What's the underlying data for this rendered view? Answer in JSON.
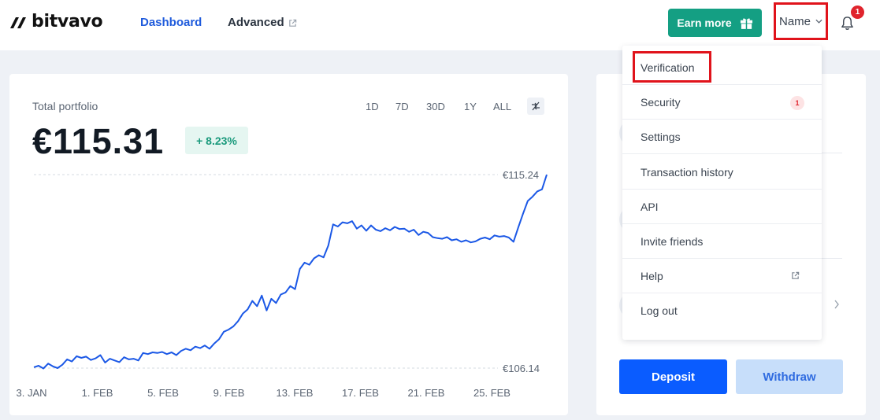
{
  "header": {
    "logo_text": "bitvavo",
    "nav": {
      "dashboard": "Dashboard",
      "advanced": "Advanced"
    },
    "earn_more_label": "Earn more",
    "user_name": "Name",
    "notification_count": "1"
  },
  "portfolio": {
    "label": "Total portfolio",
    "amount": "€115.31",
    "change": "+ 8.23%",
    "ranges": [
      "1D",
      "7D",
      "30D",
      "1Y",
      "ALL"
    ],
    "active_range": "30D"
  },
  "chart_data": {
    "type": "line",
    "x_tick_labels": [
      "3. JAN",
      "1. FEB",
      "5. FEB",
      "9. FEB",
      "13. FEB",
      "17. FEB",
      "21. FEB",
      "25. FEB"
    ],
    "reference_labels": {
      "high": "€115.24",
      "low": "€106.14"
    },
    "ylim": [
      106.14,
      115.24
    ],
    "series": [
      {
        "values": [
          106.18,
          106.25,
          106.12,
          106.35,
          106.22,
          106.14,
          106.3,
          106.55,
          106.45,
          106.7,
          106.62,
          106.68,
          106.52,
          106.6,
          106.75,
          106.4,
          106.58,
          106.5,
          106.42,
          106.65,
          106.55,
          106.58,
          106.5,
          106.85,
          106.8,
          106.88,
          106.85,
          106.9,
          106.8,
          106.88,
          106.75,
          106.95,
          107.05,
          106.98,
          107.15,
          107.08,
          107.2,
          107.05,
          107.3,
          107.5,
          107.85,
          107.95,
          108.1,
          108.35,
          108.7,
          108.9,
          109.3,
          109.05,
          109.55,
          108.85,
          109.4,
          109.2,
          109.6,
          109.7,
          110.0,
          109.85,
          110.8,
          111.1,
          111.0,
          111.3,
          111.45,
          111.35,
          111.9,
          112.9,
          112.8,
          113.0,
          112.95,
          113.05,
          112.7,
          112.85,
          112.6,
          112.85,
          112.65,
          112.58,
          112.72,
          112.62,
          112.78,
          112.68,
          112.7,
          112.55,
          112.65,
          112.4,
          112.55,
          112.5,
          112.3,
          112.25,
          112.22,
          112.3,
          112.15,
          112.2,
          112.08,
          112.15,
          112.05,
          112.1,
          112.22,
          112.28,
          112.2,
          112.38,
          112.32,
          112.35,
          112.28,
          112.08,
          112.75,
          113.4,
          114.0,
          114.2,
          114.45,
          114.55,
          115.24
        ]
      }
    ]
  },
  "dropdown": {
    "items": [
      {
        "label": "Verification"
      },
      {
        "label": "Security",
        "badge": "1"
      },
      {
        "label": "Settings"
      },
      {
        "label": "Transaction history"
      },
      {
        "label": "API"
      },
      {
        "label": "Invite friends"
      },
      {
        "label": "Help"
      },
      {
        "label": "Log out"
      }
    ]
  },
  "actions": {
    "deposit": "Deposit",
    "withdraw": "Withdraw"
  },
  "colors": {
    "brand_blue": "#1f5bdc",
    "chart_line": "#1b58e6",
    "earn_green": "#149f83",
    "deposit_blue": "#0a5cff",
    "withdraw_light": "#c7defa",
    "highlight_red": "#e0131b"
  }
}
